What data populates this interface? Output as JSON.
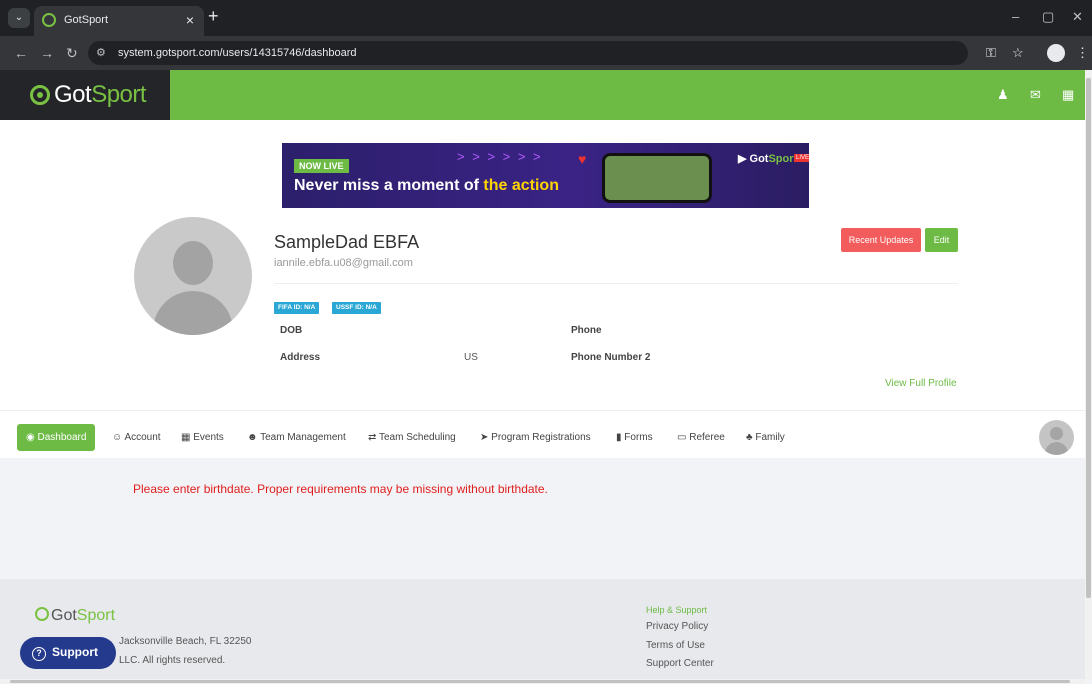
{
  "browser": {
    "tab_title": "GotSport",
    "tab_close": "×",
    "new_tab": "+",
    "url": "system.gotsport.com/users/14315746/dashboard",
    "win_min": "–",
    "win_max": "▢",
    "win_close": "✕"
  },
  "header": {
    "logo_prefix": "Got",
    "logo_suffix": "Sport"
  },
  "banner": {
    "badge": "NOW LIVE",
    "headline_prefix": "Never miss a moment of ",
    "headline_highlight": "the action",
    "arrows": "> > > > > >",
    "logo_prefix": "Got",
    "logo_suffix": "Sport",
    "live": "LIVE"
  },
  "profile": {
    "name": "SampleDad EBFA",
    "email": "iannile.ebfa.u08@gmail.com",
    "recent_updates_label": "Recent Updates",
    "edit_label": "Edit",
    "fifa_id": "FIFA ID: N/A",
    "ussf_id": "USSF ID: N/A",
    "dob_label": "DOB",
    "dob_value": "",
    "address_label": "Address",
    "address_value": "US",
    "phone_label": "Phone",
    "phone_value": "",
    "phone2_label": "Phone Number 2",
    "phone2_value": "",
    "view_full_profile": "View Full Profile"
  },
  "nav": {
    "dashboard": "Dashboard",
    "account": "Account",
    "events": "Events",
    "team_management": "Team Management",
    "team_scheduling": "Team Scheduling",
    "program_registrations": "Program Registrations",
    "forms": "Forms",
    "referee": "Referee",
    "family": "Family"
  },
  "warning": "Please enter birthdate. Proper requirements may be missing without birthdate.",
  "footer": {
    "logo_prefix": "Got",
    "logo_suffix": "Sport",
    "address": "Jacksonville Beach, FL 32250",
    "copyright": "LLC. All rights reserved.",
    "help_heading": "Help & Support",
    "privacy": "Privacy Policy",
    "terms": "Terms of Use",
    "support_center": "Support Center",
    "support_button": "Support"
  },
  "colors": {
    "brand_green": "#6dbb45",
    "logo_dark": "#232528",
    "alert_red": "#f25c5c",
    "badge_blue": "#2aa7d4",
    "support_blue": "#243a8c"
  }
}
